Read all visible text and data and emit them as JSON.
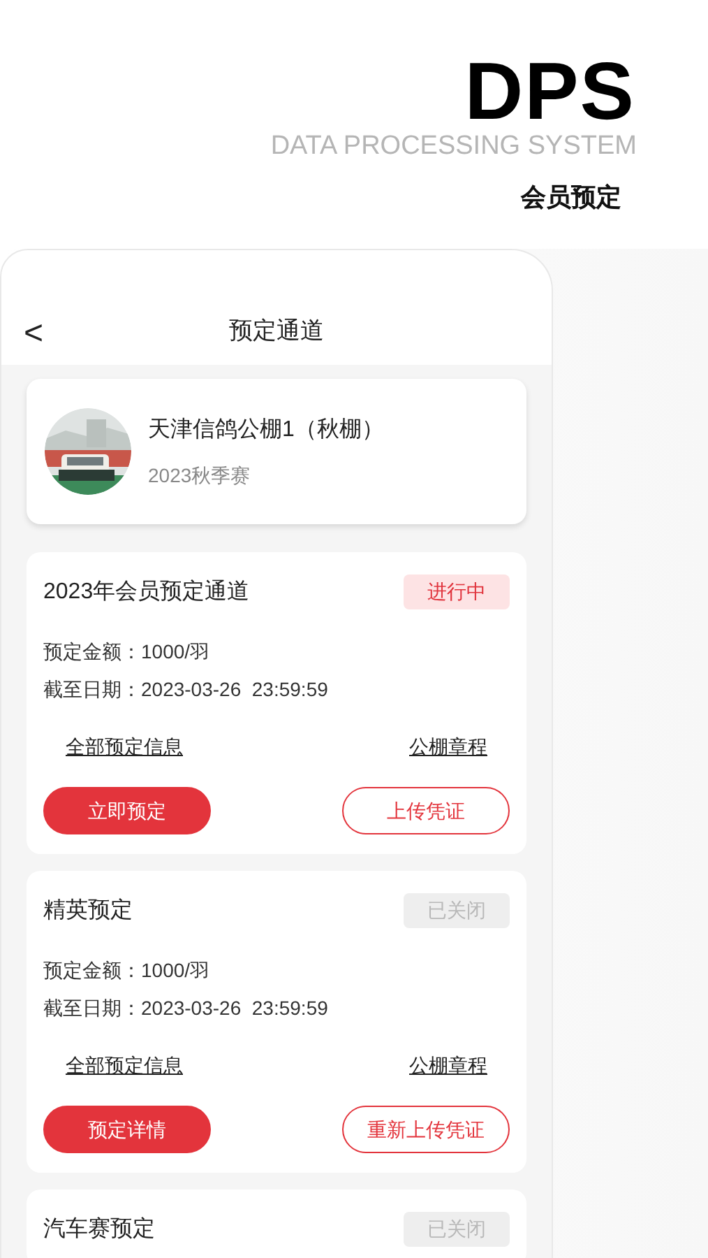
{
  "brand": {
    "logo": "DPS",
    "tagline": "DATA PROCESSING SYSTEM",
    "subtitle": "会员预定"
  },
  "nav": {
    "back": "<",
    "title": "预定通道"
  },
  "club": {
    "name": "天津信鸽公棚1（秋棚）",
    "season": "2023秋季赛"
  },
  "channels": [
    {
      "title": "2023年会员预定通道",
      "status": {
        "kind": "open",
        "label": "进行中"
      },
      "fee": "预定金额：1000/羽",
      "deadline": "截至日期：2023-03-26  23:59:59",
      "links": [
        "全部预定信息",
        "公棚章程"
      ],
      "buttons": [
        {
          "kind": "filled",
          "label": "立即预定"
        },
        {
          "kind": "outline",
          "label": "上传凭证"
        }
      ]
    },
    {
      "title": "精英预定",
      "status": {
        "kind": "closed",
        "label": "已关闭"
      },
      "fee": "预定金额：1000/羽",
      "deadline": "截至日期：2023-03-26  23:59:59",
      "links": [
        "全部预定信息",
        "公棚章程"
      ],
      "buttons": [
        {
          "kind": "filled",
          "label": "预定详情"
        },
        {
          "kind": "outline",
          "label": "重新上传凭证"
        }
      ]
    },
    {
      "title": "汽车赛预定",
      "status": {
        "kind": "closed",
        "label": "已关闭"
      }
    }
  ]
}
